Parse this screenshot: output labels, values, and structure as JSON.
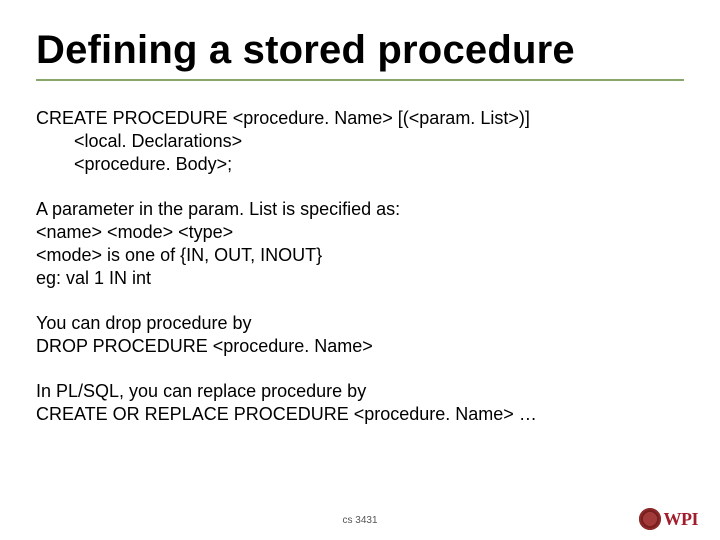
{
  "title": "Defining a stored procedure",
  "code": {
    "line1": "CREATE PROCEDURE <procedure. Name> [(<param. List>)]",
    "line2": "<local. Declarations>",
    "line3": "<procedure. Body>;"
  },
  "para1": {
    "l1": "A parameter in the param. List is specified as:",
    "l2": "<name> <mode> <type>",
    "l3": "<mode> is one of {IN, OUT, INOUT}",
    "l4": "eg: val 1 IN int"
  },
  "para2": {
    "l1": "You can drop procedure by",
    "l2": "DROP PROCEDURE <procedure. Name>"
  },
  "para3": {
    "l1": "In PL/SQL, you can replace procedure by",
    "l2": "CREATE OR REPLACE PROCEDURE <procedure. Name> …"
  },
  "footer": "cs 3431",
  "logo_text": "WPI"
}
